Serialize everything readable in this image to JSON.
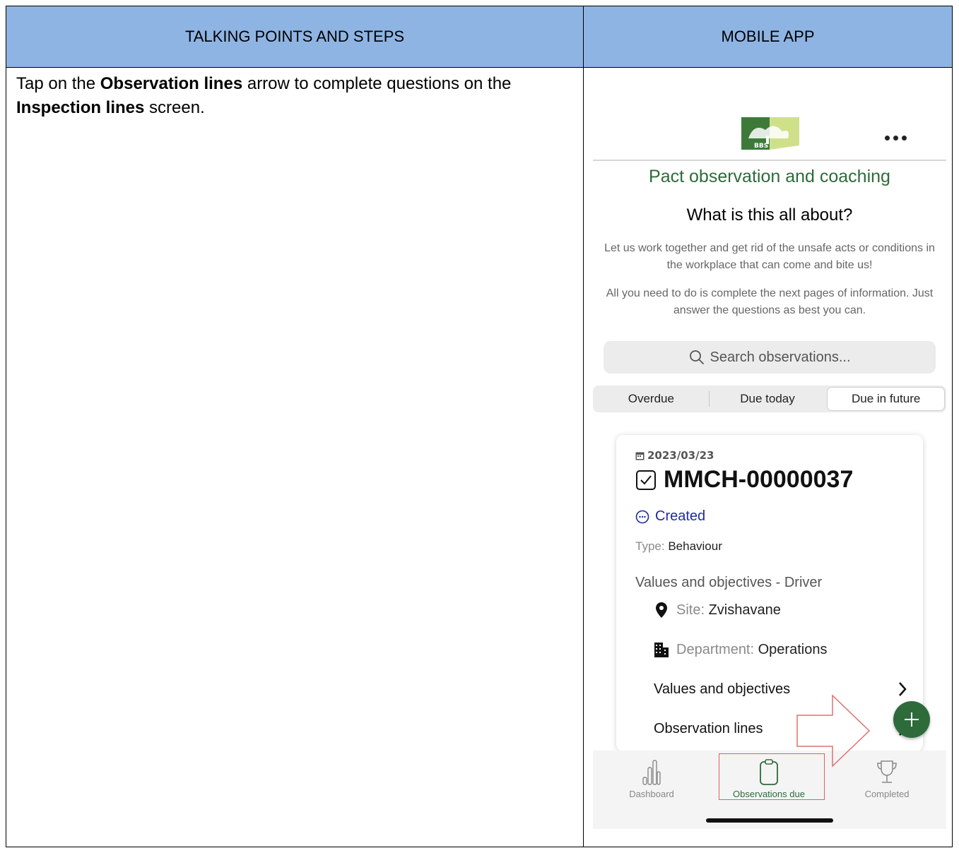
{
  "table": {
    "col1_header": "TALKING POINTS AND STEPS",
    "col2_header": "MOBILE APP"
  },
  "instruction": {
    "p1": "Tap on the ",
    "b1": "Observation lines",
    "p2": " arrow to complete questions on the ",
    "b2": "Inspection lines",
    "p3": " screen."
  },
  "app": {
    "logo_text": "BBS",
    "title": "Pact observation and coaching",
    "heading": "What is this all about?",
    "para1": "Let us work together and get rid of the unsafe acts or conditions in the workplace that can come and bite us!",
    "para2": "All you need to do is complete the next pages of information. Just answer the questions as best you can.",
    "search_placeholder": "Search observations...",
    "tabs": [
      "Overdue",
      "Due today",
      "Due in future"
    ],
    "card": {
      "date": "2023/03/23",
      "id": "MMCH-00000037",
      "status": "Created",
      "type_label": "Type:",
      "type_value": "Behaviour",
      "values_title": "Values and objectives - Driver",
      "site_label": "Site:",
      "site_value": "Zvishavane",
      "department_label": "Department:",
      "department_value": "Operations",
      "link1": "Values and objectives",
      "link2": "Observation lines"
    },
    "bottom_nav": [
      "Dashboard",
      "Observations due",
      "Completed"
    ],
    "colors": {
      "brand_green": "#2e6b3a",
      "status_blue": "#1f2aa0",
      "header_blue": "#8eb4e3"
    }
  }
}
